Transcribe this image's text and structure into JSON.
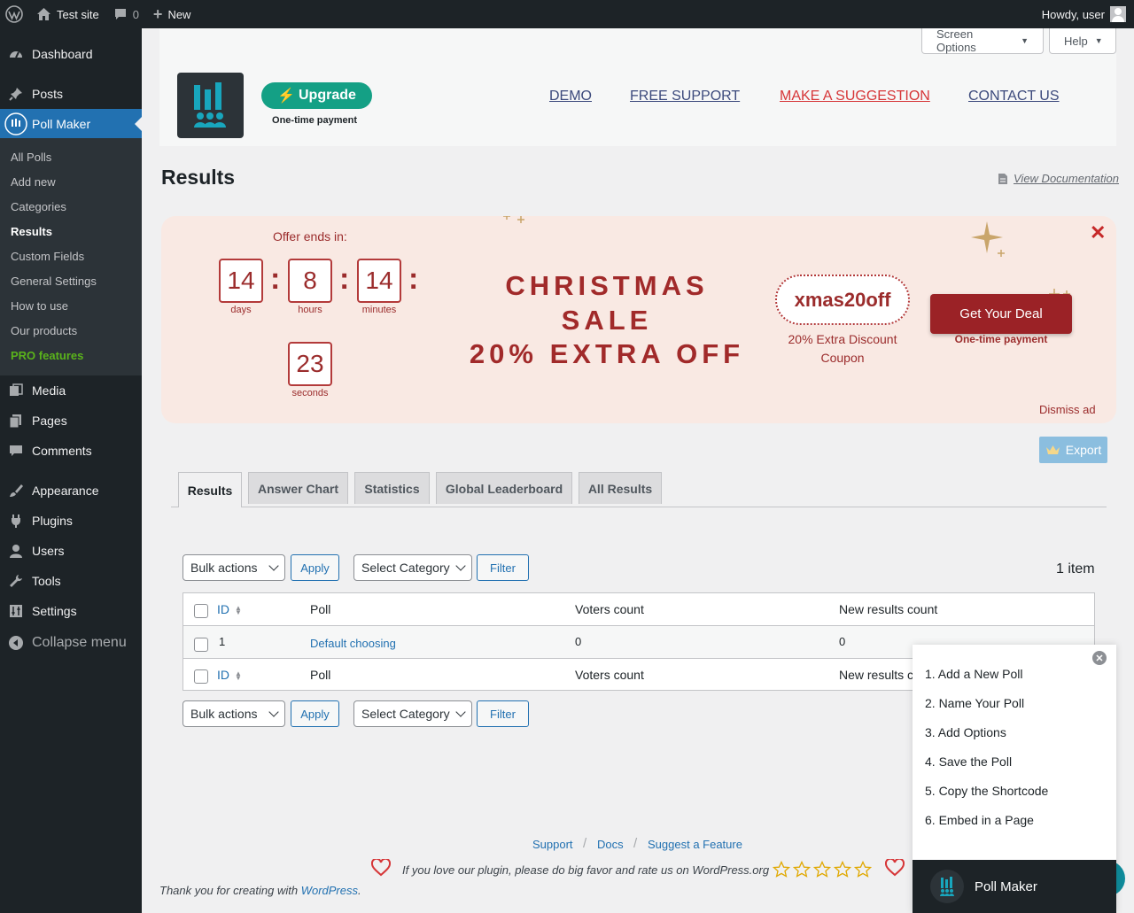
{
  "adminbar": {
    "site_name": "Test site",
    "comments_count": "0",
    "new_label": "New",
    "howdy": "Howdy, user"
  },
  "sidebar": {
    "items": [
      {
        "label": "Dashboard",
        "icon": "dashboard-icon"
      },
      {
        "label": "Posts",
        "icon": "pin-icon"
      },
      {
        "label": "Poll Maker",
        "icon": "poll-maker-icon"
      },
      {
        "label": "Media",
        "icon": "media-icon"
      },
      {
        "label": "Pages",
        "icon": "pages-icon"
      },
      {
        "label": "Comments",
        "icon": "comment-icon"
      },
      {
        "label": "Appearance",
        "icon": "brush-icon"
      },
      {
        "label": "Plugins",
        "icon": "plug-icon"
      },
      {
        "label": "Users",
        "icon": "user-icon"
      },
      {
        "label": "Tools",
        "icon": "wrench-icon"
      },
      {
        "label": "Settings",
        "icon": "settings-icon"
      }
    ],
    "submenu": [
      "All Polls",
      "Add new",
      "Categories",
      "Results",
      "Custom Fields",
      "General Settings",
      "How to use",
      "Our products",
      "PRO features"
    ],
    "collapse": "Collapse menu"
  },
  "header": {
    "screen_options": "Screen Options",
    "help": "Help",
    "upgrade": "Upgrade",
    "upgrade_sub": "One-time payment",
    "links": [
      "DEMO",
      "FREE SUPPORT",
      "MAKE A SUGGESTION",
      "CONTACT US"
    ]
  },
  "page": {
    "title": "Results",
    "view_doc": "View Documentation"
  },
  "banner": {
    "offer_label": "Offer ends in:",
    "countdown": [
      {
        "value": "14",
        "unit": "days"
      },
      {
        "value": "8",
        "unit": "hours"
      },
      {
        "value": "14",
        "unit": "minutes"
      },
      {
        "value": "23",
        "unit": "seconds"
      }
    ],
    "sale_lines": [
      "CHRISTMAS",
      "SALE",
      "20% EXTRA OFF"
    ],
    "coupon_code": "xmas20off",
    "coupon_sub": "20% Extra Discount Coupon",
    "deal_button": "Get Your Deal",
    "deal_sub": "One-time payment",
    "dismiss": "Dismiss ad",
    "accent": "#9b2226",
    "background": "#f9e9e3"
  },
  "export": "Export",
  "tabs": [
    "Results",
    "Answer Chart",
    "Statistics",
    "Global Leaderboard",
    "All Results"
  ],
  "controls": {
    "bulk_actions": "Bulk actions",
    "apply": "Apply",
    "select_category": "Select Category",
    "filter": "Filter",
    "items_count": "1 item"
  },
  "table": {
    "columns": [
      "ID",
      "Poll",
      "Voters count",
      "New results count"
    ],
    "rows": [
      {
        "id": "1",
        "poll": "Default choosing",
        "voters": "0",
        "new_results": "0"
      }
    ],
    "footer_new_results": "New results c"
  },
  "guide": {
    "steps": [
      "1. Add a New Poll",
      "2. Name Your Poll",
      "3. Add Options",
      "4. Save the Poll",
      "5. Copy the Shortcode",
      "6. Embed in a Page"
    ],
    "title": "Poll Maker"
  },
  "footer": {
    "links": [
      "Support",
      "Docs",
      "Suggest a Feature"
    ],
    "rate_text": "If you love our plugin, please do big favor and rate us on WordPress.org",
    "thanks_prefix": "Thank you for creating with",
    "thanks_link": "WordPress",
    "thanks_suffix": "."
  }
}
